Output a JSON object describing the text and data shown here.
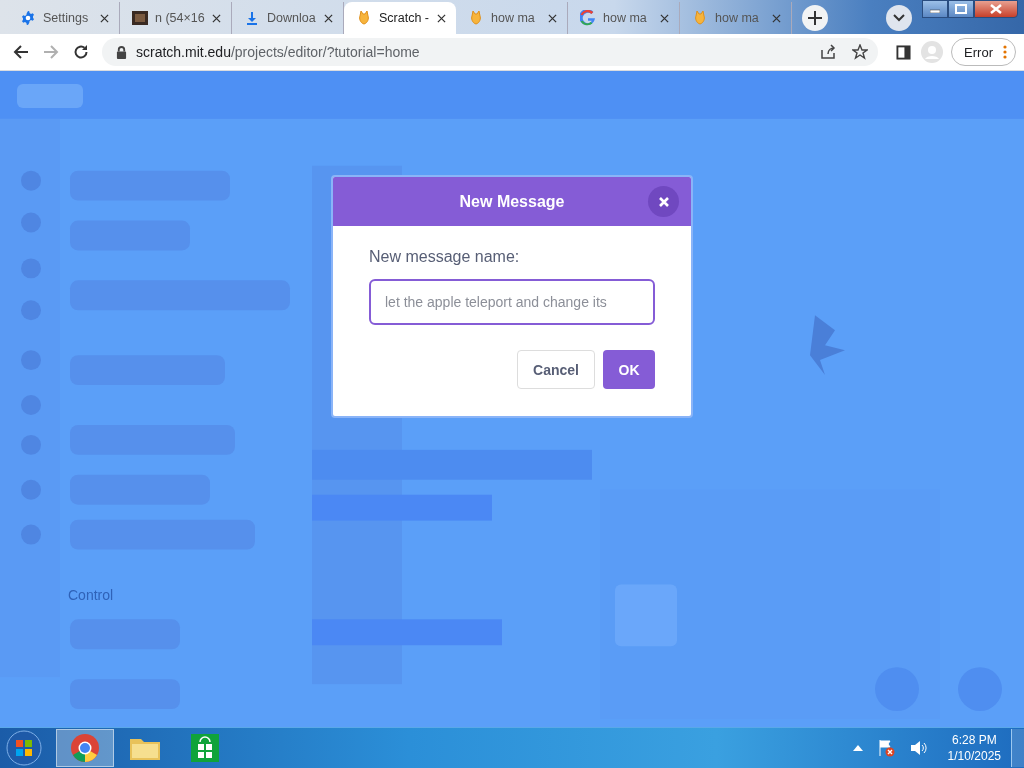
{
  "browser": {
    "tabs": [
      {
        "kind": "settings",
        "title": "Settings",
        "selected": false
      },
      {
        "kind": "image",
        "title": "n (54×16",
        "selected": false
      },
      {
        "kind": "download",
        "title": "Downloa",
        "selected": false
      },
      {
        "kind": "scratch",
        "title": "Scratch -",
        "selected": true
      },
      {
        "kind": "scratch",
        "title": "how ma",
        "selected": false
      },
      {
        "kind": "google",
        "title": "how ma",
        "selected": false
      },
      {
        "kind": "scratch",
        "title": "how ma",
        "selected": false
      }
    ],
    "url_host": "scratch.mit.edu",
    "url_path": "/projects/editor/?tutorial=home",
    "forward_disabled": true,
    "profile_status": "Error"
  },
  "editor_backdrop": {
    "category_heading": "Control"
  },
  "dialog": {
    "title": "New Message",
    "label": "New message name:",
    "value": "let the apple teleport and change its",
    "buttons": [
      {
        "kind": "secondary",
        "label": "Cancel"
      },
      {
        "kind": "primary",
        "label": "OK"
      }
    ]
  },
  "taskbar": {
    "time": "6:28 PM",
    "date": "1/10/2025"
  }
}
